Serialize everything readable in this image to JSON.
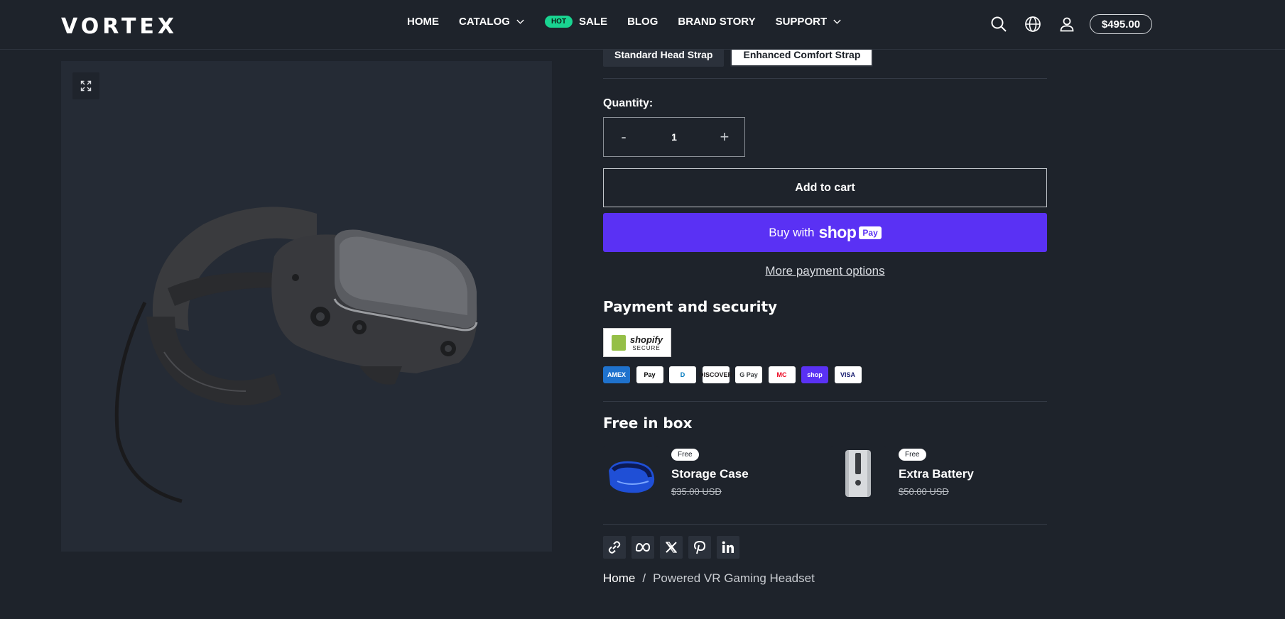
{
  "header": {
    "logo": "VORTEX",
    "nav": [
      {
        "label": "HOME"
      },
      {
        "label": "CATALOG"
      },
      {
        "label": "SALE",
        "badge": "HOT"
      },
      {
        "label": "BLOG"
      },
      {
        "label": "BRAND STORY"
      },
      {
        "label": "SUPPORT"
      }
    ],
    "cart_total": "$495.00",
    "icons": [
      "search-icon",
      "globe-icon",
      "account-icon"
    ]
  },
  "gallery": {
    "zoom_icon": "expand-icon",
    "image_alt": "VR headset"
  },
  "product": {
    "strap_options": [
      "Standard Head Strap",
      "Enhanced Comfort Strap"
    ],
    "selected_strap": "Enhanced Comfort Strap",
    "quantity_label": "Quantity:",
    "quantity": "1",
    "decrement": "-",
    "increment": "+",
    "add_to_cart": "Add to cart",
    "buy_with": "Buy with",
    "shop_word": "shop",
    "pay_word": "Pay",
    "more_payment": "More payment options"
  },
  "payment": {
    "title": "Payment and security",
    "badge_line1": "shopify",
    "badge_line2": "SECURE",
    "methods": [
      {
        "name": "AMEX",
        "bg": "#1f72cd",
        "fg": "#ffffff"
      },
      {
        "name": "Pay",
        "bg": "#ffffff",
        "fg": "#000000"
      },
      {
        "name": "D",
        "bg": "#ffffff",
        "fg": "#0079be"
      },
      {
        "name": "DISCOVER",
        "bg": "#ffffff",
        "fg": "#231f20"
      },
      {
        "name": "G Pay",
        "bg": "#ffffff",
        "fg": "#3c4043"
      },
      {
        "name": "MC",
        "bg": "#ffffff",
        "fg": "#eb001b"
      },
      {
        "name": "shop",
        "bg": "#5a31f4",
        "fg": "#ffffff"
      },
      {
        "name": "VISA",
        "bg": "#ffffff",
        "fg": "#1a1f71"
      }
    ]
  },
  "free_in_box": {
    "title": "Free in box",
    "items": [
      {
        "badge": "Free",
        "name": "Storage Case",
        "price": "$35.00 USD"
      },
      {
        "badge": "Free",
        "name": "Extra Battery",
        "price": "$50.00 USD"
      }
    ]
  },
  "share": [
    "link-icon",
    "meta-icon",
    "x-icon",
    "pinterest-icon",
    "linkedin-icon"
  ],
  "breadcrumb": {
    "home": "Home",
    "separator": "/",
    "current": "Powered VR Gaming Headset"
  }
}
